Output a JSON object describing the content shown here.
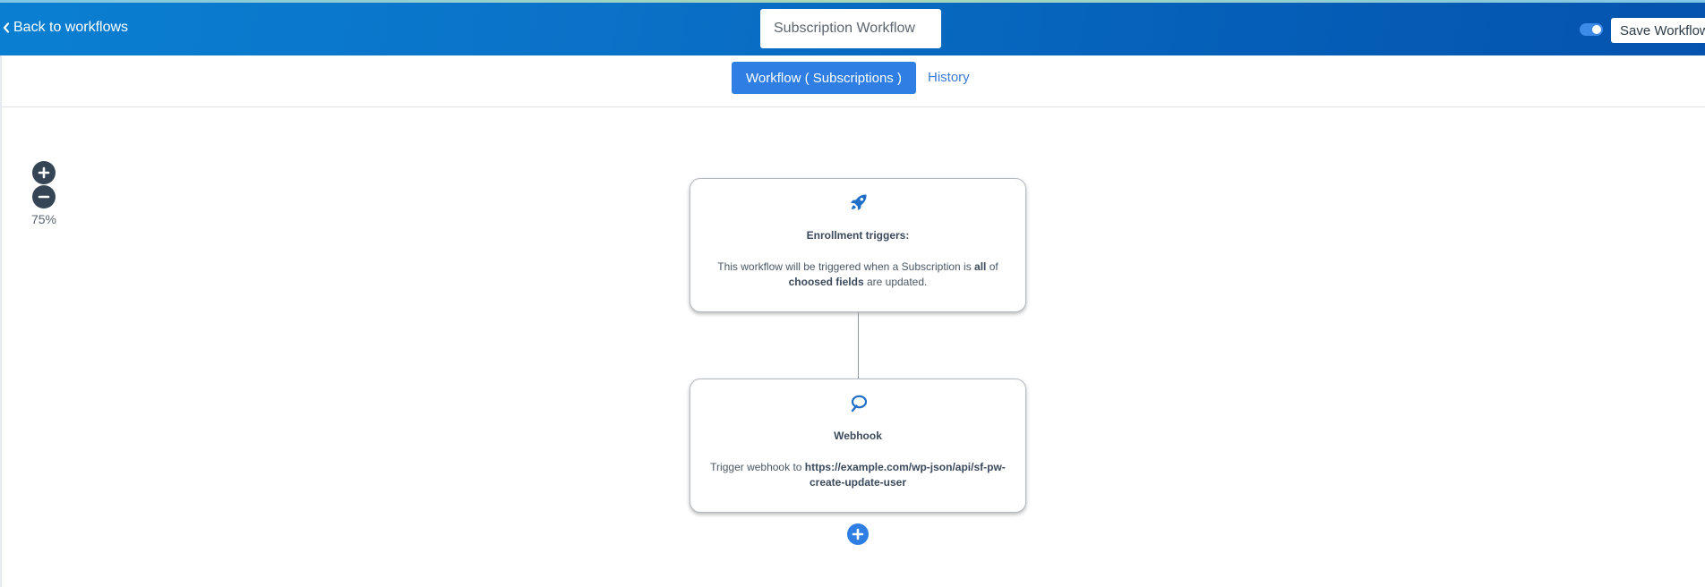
{
  "header": {
    "back_label": "Back to workflows",
    "workflow_name": "Subscription Workflow",
    "active_toggle": true,
    "save_label": "Save Workflow"
  },
  "tabs": {
    "workflow_label": "Workflow ( Subscriptions )",
    "history_label": "History"
  },
  "zoom": {
    "level": "75%"
  },
  "nodes": {
    "trigger": {
      "icon": "rocket-icon",
      "title": "Enrollment triggers:",
      "desc_pre": "This workflow will be triggered when a Subscription is ",
      "desc_bold1": "all",
      "desc_mid": " of ",
      "desc_bold2": "choosed fields",
      "desc_post": " are updated."
    },
    "webhook": {
      "icon": "webhook-icon",
      "title": "Webhook",
      "desc_pre": "Trigger webhook to ",
      "url": "https://example.com/wp-json/api/sf-pw-create-update-user"
    }
  },
  "colors": {
    "header_start": "#0a7fd1",
    "header_end": "#0553ad",
    "primary": "#2f7ee3",
    "zoom_button": "#364556",
    "icon": "#1f6fc9"
  }
}
